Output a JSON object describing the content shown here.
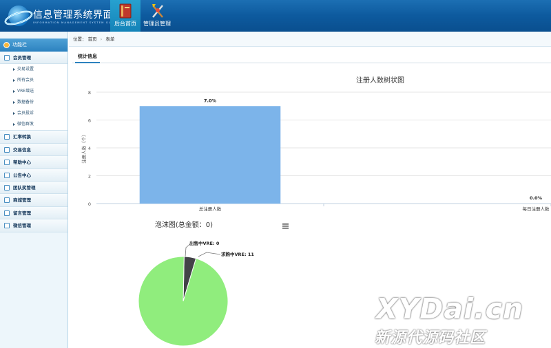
{
  "header": {
    "title": "信息管理系统界面",
    "subtitle": "INFORMATION MANAGEMENT SYSTEM GUI",
    "nav": [
      {
        "label": "后台首页",
        "icon": "book-icon"
      },
      {
        "label": "管理员管理",
        "icon": "tools-icon"
      }
    ]
  },
  "sidebar": {
    "header": "功能栏",
    "groups": [
      {
        "label": "会员管理",
        "items": [
          "交易设置",
          "所有会员",
          "VRE增送",
          "数据备份",
          "会员投诉",
          "微信群发"
        ]
      },
      {
        "label": "汇率转换",
        "items": []
      },
      {
        "label": "交易信息",
        "items": []
      },
      {
        "label": "帮助中心",
        "items": []
      },
      {
        "label": "公告中心",
        "items": []
      },
      {
        "label": "团队奖管理",
        "items": []
      },
      {
        "label": "商城管理",
        "items": []
      },
      {
        "label": "留言管理",
        "items": []
      },
      {
        "label": "微信管理",
        "items": []
      }
    ]
  },
  "breadcrumb": {
    "prefix": "位置：",
    "home": "首页",
    "sep": "›",
    "current": "表单"
  },
  "tab": {
    "label": "统计信息"
  },
  "chart_data": [
    {
      "type": "bar",
      "title": "注册人数树状图",
      "ylabel": "注册人数（个）",
      "categories": [
        "总注册人数",
        "每日注册人数"
      ],
      "values": [
        7,
        0
      ],
      "data_labels": [
        "7.0%",
        "0.0%"
      ],
      "ylim": [
        0,
        8
      ],
      "yticks": [
        0,
        2,
        4,
        6,
        8
      ],
      "grid": true,
      "colors": [
        "#7cb4ea"
      ]
    },
    {
      "type": "pie",
      "title": "泡沫图(总金额：0)",
      "labels": [
        "出售中VRE",
        "求购中VRE"
      ],
      "values": [
        0,
        11
      ],
      "display_labels": [
        "出售中VRE: 0",
        "求购中VRE: 11"
      ],
      "colors": [
        "#434348",
        "#90ed7d"
      ]
    }
  ],
  "watermark": {
    "line1": "XYDai.cn",
    "line2": "新源代源码社区"
  }
}
